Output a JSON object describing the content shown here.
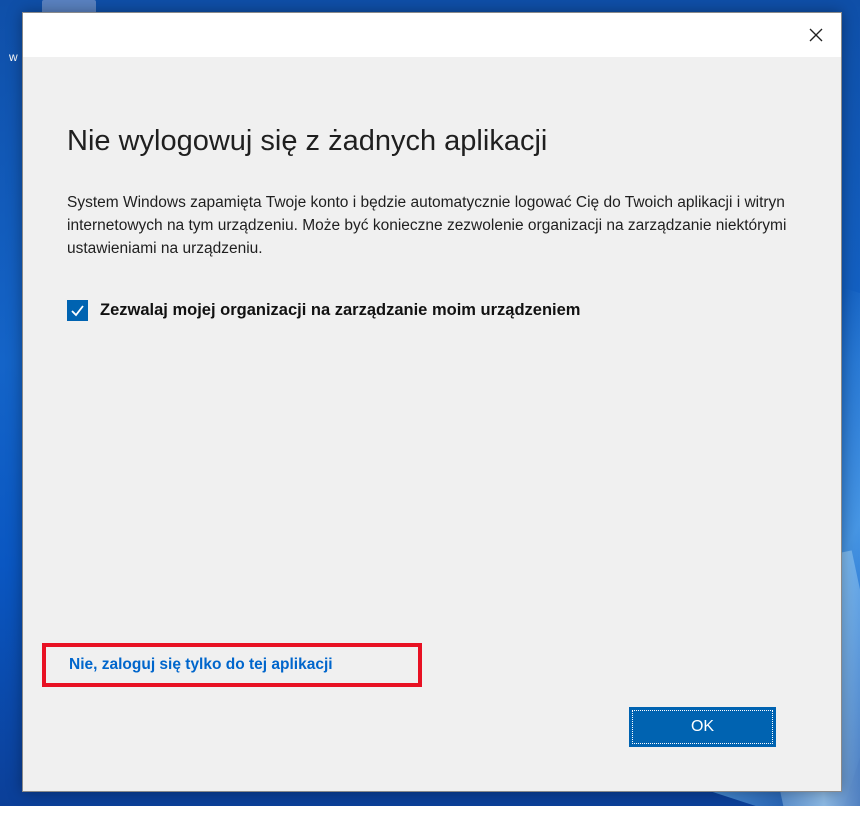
{
  "desktop": {
    "icon_letter": "w"
  },
  "dialog": {
    "close_icon": "close-icon",
    "heading": "Nie wylogowuj się z żadnych aplikacji",
    "description": "System Windows zapamięta Twoje konto i będzie automatycznie logować Cię do Twoich aplikacji i witryn internetowych na tym urządzeniu. Może być konieczne zezwolenie organizacji na zarządzanie niektórymi ustawieniami na urządzeniu.",
    "checkbox": {
      "label": "Zezwalaj mojej organizacji na zarządzanie moim urządzeniem",
      "checked": true,
      "icon": "checkmark-icon"
    },
    "link_text": "Nie, zaloguj się tylko do tej aplikacji",
    "ok_label": "OK"
  },
  "colors": {
    "accent": "#0063b1",
    "link": "#0066cc",
    "highlight": "#e81123",
    "dialog_bg": "#f0f0f0"
  }
}
